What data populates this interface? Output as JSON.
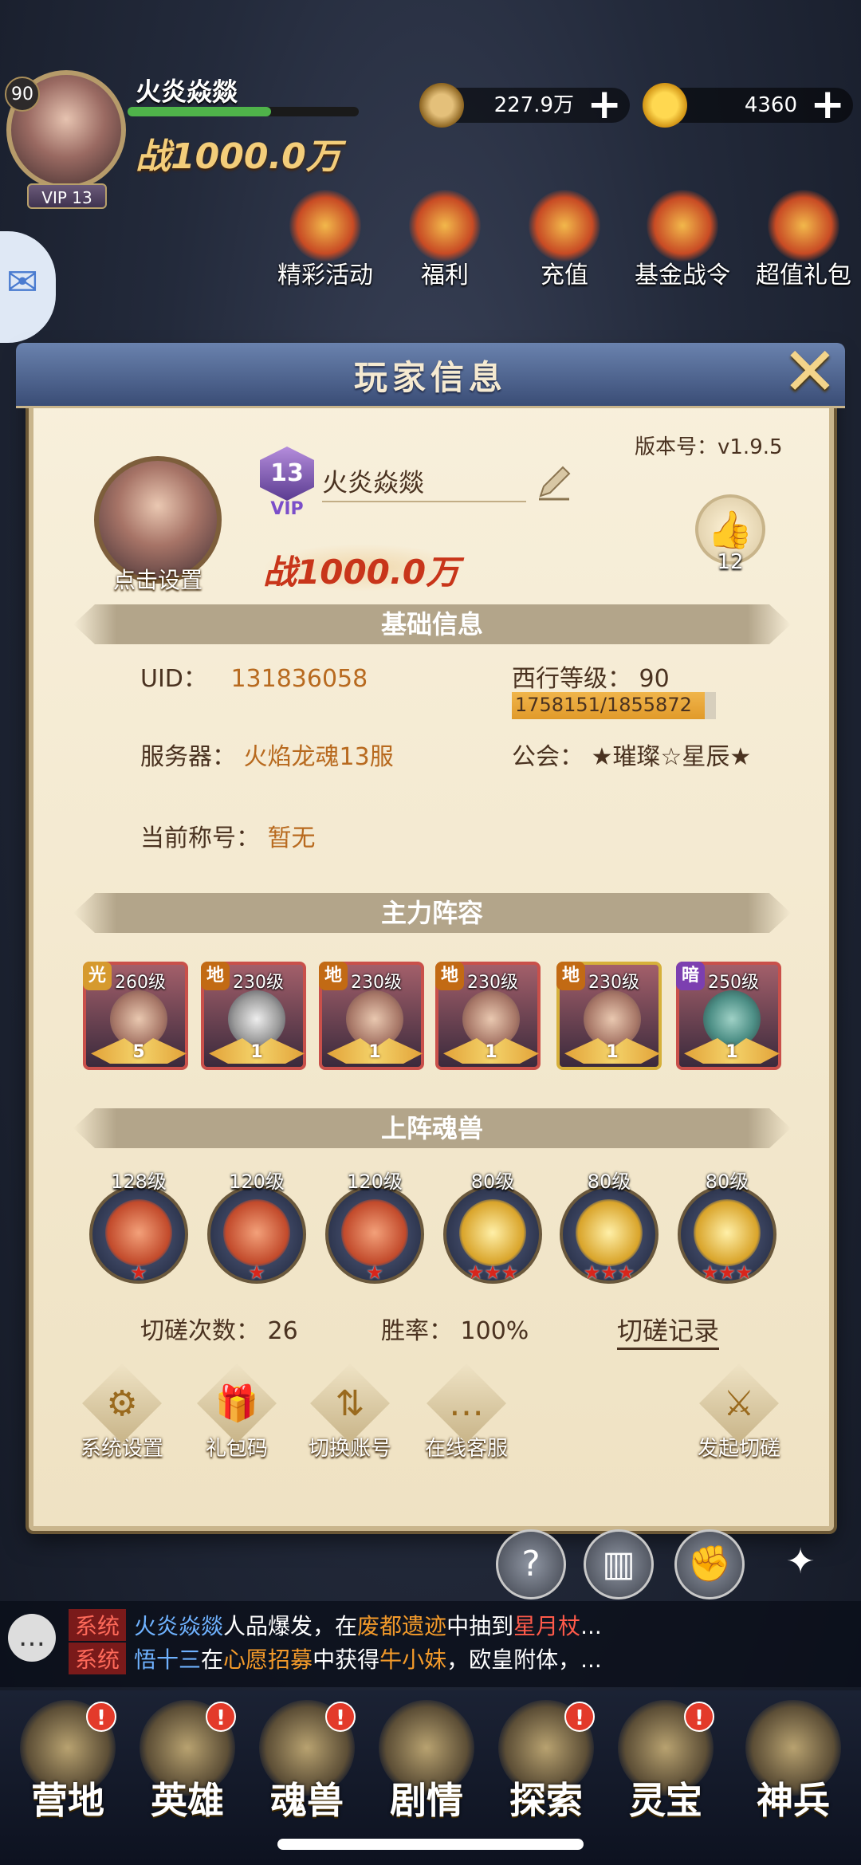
{
  "hud": {
    "level": "90",
    "name": "火炎焱燚",
    "vip": "VIP 13",
    "power": "战1000.0万",
    "exp_fraction": 0.62,
    "coins": "227.9万",
    "gold": "4360",
    "plus": "+",
    "menu": [
      "精彩活动",
      "福利",
      "充值",
      "基金战令",
      "超值礼包"
    ]
  },
  "panel": {
    "title": "玩家信息",
    "close": "✕",
    "version": "版本号：v1.9.5",
    "avatar_label": "点击设置",
    "vip_level": "13",
    "vip_text": "VIP",
    "player_name": "火炎焱燚",
    "power": "战1000.0万",
    "likes": "12"
  },
  "basic": {
    "title": "基础信息",
    "uid_label": "UID：",
    "uid": "131836058",
    "level_label": "西行等级：",
    "level": "90",
    "exp_text": "1758151/1855872",
    "exp_fraction": 0.947,
    "server_label": "服务器：",
    "server": "火焰龙魂13服",
    "guild_label": "公会：",
    "guild": "★璀璨☆星辰★",
    "title_label": "当前称号：",
    "title_value": "暂无"
  },
  "lineup": {
    "title": "主力阵容",
    "heroes": [
      {
        "element": "光",
        "level": "260级",
        "stars": "5"
      },
      {
        "element": "地",
        "level": "230级",
        "stars": "1"
      },
      {
        "element": "地",
        "level": "230级",
        "stars": "1"
      },
      {
        "element": "地",
        "level": "230级",
        "stars": "1"
      },
      {
        "element": "地",
        "level": "230级",
        "stars": "1"
      },
      {
        "element": "暗",
        "level": "250级",
        "stars": "1"
      }
    ]
  },
  "beasts": {
    "title": "上阵魂兽",
    "items": [
      {
        "level": "128级",
        "stars": "★"
      },
      {
        "level": "120级",
        "stars": "★"
      },
      {
        "level": "120级",
        "stars": "★"
      },
      {
        "level": "80级",
        "stars": "★★★"
      },
      {
        "level": "80级",
        "stars": "★★★"
      },
      {
        "level": "80级",
        "stars": "★★★"
      }
    ]
  },
  "stats": {
    "duel_label": "切磋次数：",
    "duel_count": "26",
    "win_label": "胜率：",
    "win_rate": "100%",
    "record_link": "切磋记录"
  },
  "buttons": [
    "系统设置",
    "礼包码",
    "切换账号",
    "在线客服",
    "发起切磋"
  ],
  "chat": {
    "line1": {
      "tag": "系统",
      "name": "火炎焱燚",
      "t1": "人品爆发，在",
      "place": "废都遗迹",
      "t2": "中抽到",
      "item": "星月杖",
      "t3": "..."
    },
    "line2": {
      "tag": "系统",
      "name": "悟十三",
      "t1": "在",
      "place": "心愿招募",
      "t2": "中获得",
      "item": "牛小妹",
      "t3": "，欧皇附体，..."
    }
  },
  "nav": [
    "营地",
    "英雄",
    "魂兽",
    "剧情",
    "探索",
    "灵宝",
    "神兵"
  ],
  "nav_badge": "!"
}
